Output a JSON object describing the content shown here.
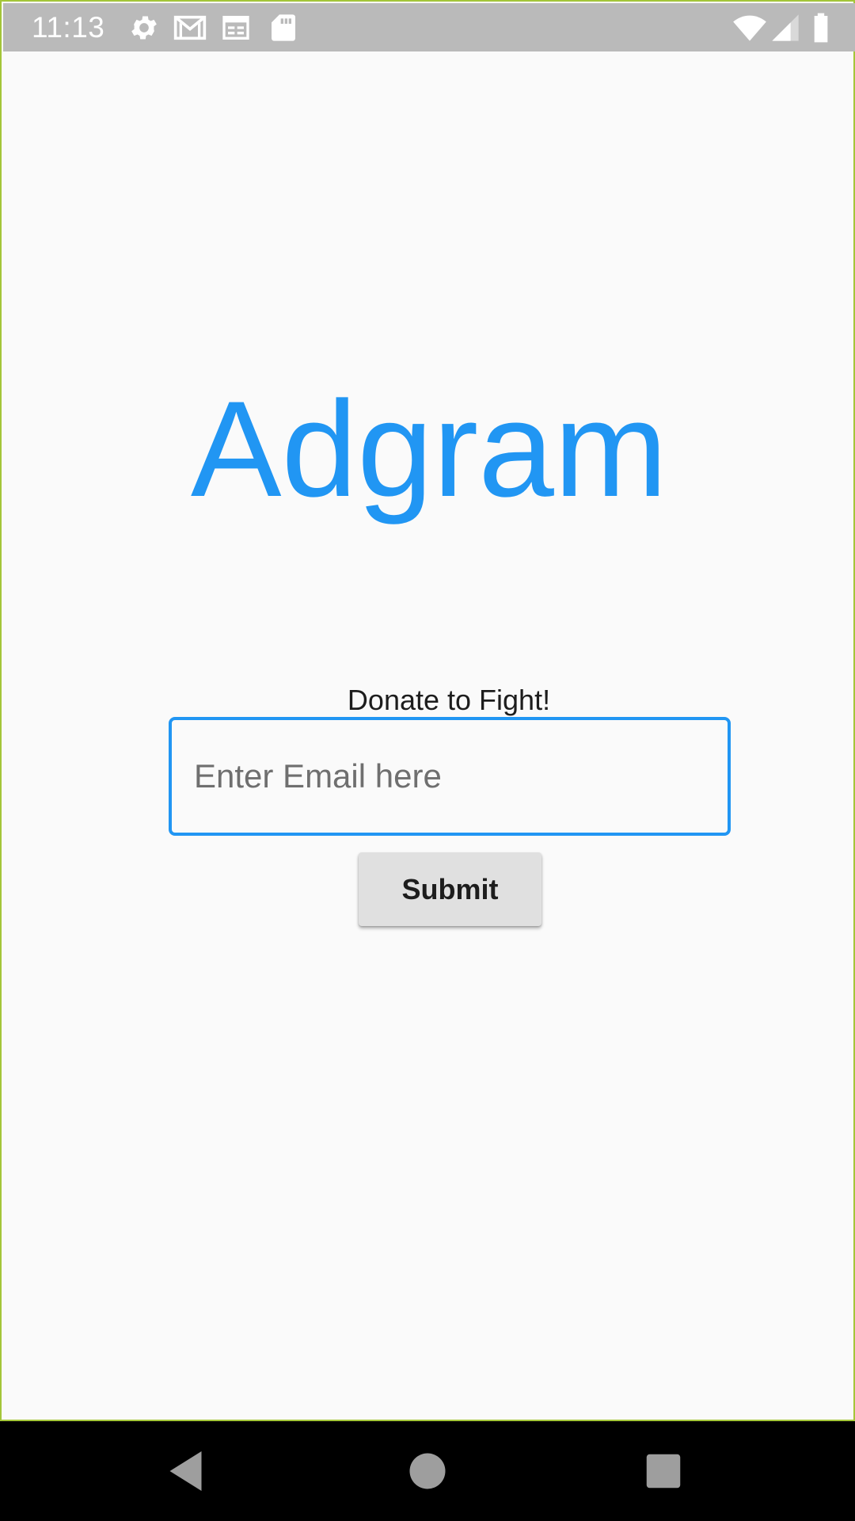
{
  "status_bar": {
    "time": "11:13",
    "left_icons": [
      "settings-icon",
      "gmail-icon",
      "calendar-icon",
      "sd-card-icon"
    ],
    "right_icons": [
      "wifi-icon",
      "cell-signal-icon",
      "battery-icon"
    ],
    "icon_color": "#ffffff",
    "background": "#bababa"
  },
  "app": {
    "title": "Adgram",
    "accent_color": "#2196f3"
  },
  "donate_form": {
    "label": "Donate to Fight!",
    "email_placeholder": "Enter Email here",
    "email_value": "",
    "submit_label": "Submit"
  },
  "nav_bar": {
    "buttons": [
      "back-icon",
      "home-icon",
      "recents-icon"
    ]
  }
}
